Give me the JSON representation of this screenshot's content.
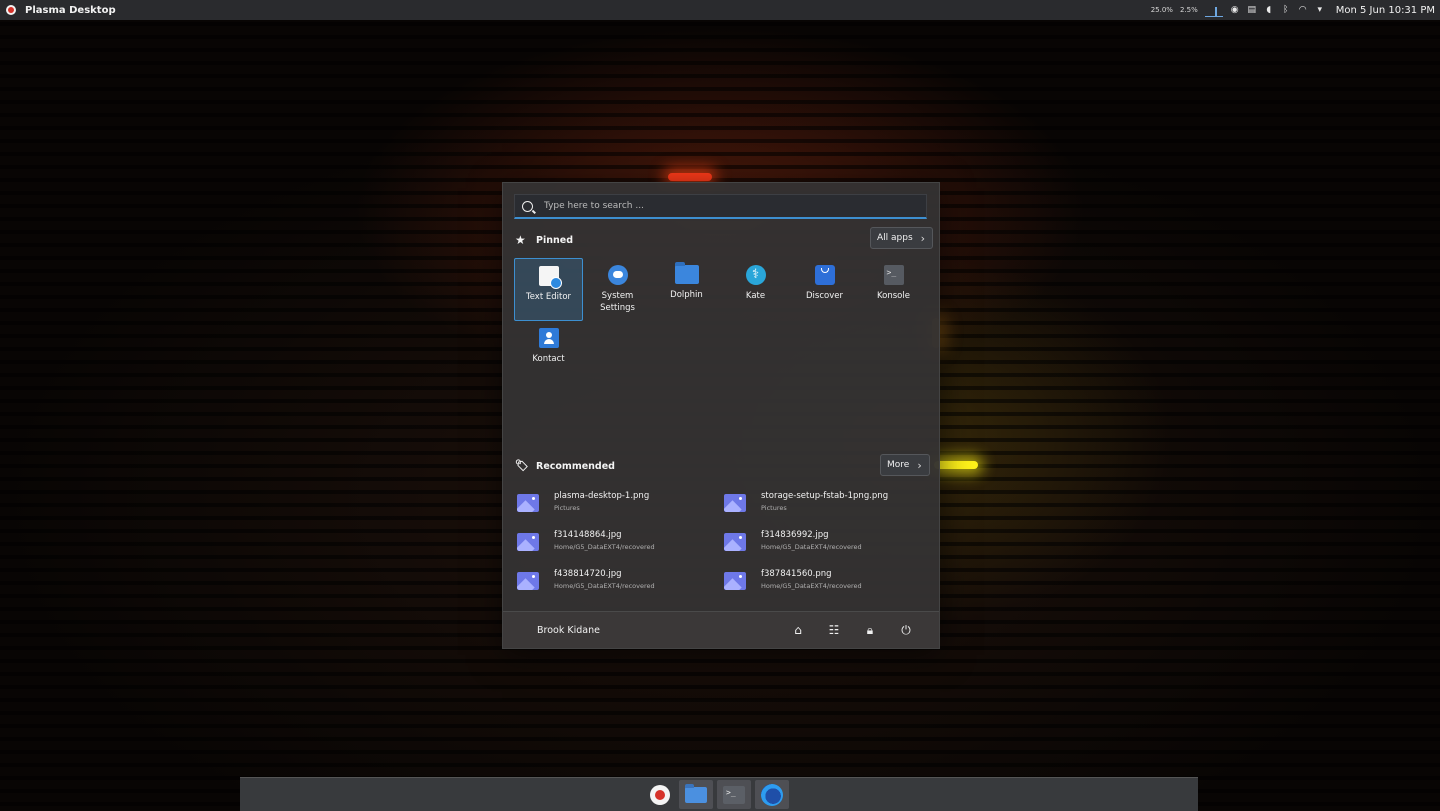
{
  "top_panel": {
    "active_window": "Plasma Desktop",
    "cpu_stat": "25.0%",
    "mem_stat": "2.5%",
    "clock": "Mon 5 Jun  10:31 PM",
    "tray_icons": [
      "graph-icon",
      "disk-icon",
      "clipboard-icon",
      "volume-icon",
      "bluetooth-icon",
      "wifi-icon",
      "expand-icon"
    ]
  },
  "menu": {
    "search_placeholder": "Type here to search ...",
    "pinned_label": "Pinned",
    "all_apps_label": "All apps",
    "pinned_apps": [
      {
        "label": "Text Editor",
        "icon": "text-editor-icon"
      },
      {
        "label": "System Settings",
        "icon": "system-settings-icon"
      },
      {
        "label": "Dolphin",
        "icon": "dolphin-icon"
      },
      {
        "label": "Kate",
        "icon": "kate-icon"
      },
      {
        "label": "Discover",
        "icon": "discover-icon"
      },
      {
        "label": "Konsole",
        "icon": "konsole-icon"
      },
      {
        "label": "Kontact",
        "icon": "kontact-icon"
      }
    ],
    "recommended_label": "Recommended",
    "more_label": "More",
    "recent": [
      {
        "name": "plasma-desktop-1.png",
        "path": "Pictures"
      },
      {
        "name": "storage-setup-fstab-1png.png",
        "path": "Pictures"
      },
      {
        "name": "f314148864.jpg",
        "path": "Home/G5_DataEXT4/recovered"
      },
      {
        "name": "f314836992.jpg",
        "path": "Home/G5_DataEXT4/recovered"
      },
      {
        "name": "f438814720.jpg",
        "path": "Home/G5_DataEXT4/recovered"
      },
      {
        "name": "f387841560.png",
        "path": "Home/G5_DataEXT4/recovered"
      }
    ],
    "user_name": "Brook Kidane"
  },
  "dock": {
    "items": [
      "launcher-icon",
      "file-manager-icon",
      "terminal-icon",
      "firefox-icon"
    ]
  },
  "colors": {
    "accent": "#3d8fd0",
    "panel_bg": "#2a2b2e",
    "menu_bg": "#343232"
  }
}
